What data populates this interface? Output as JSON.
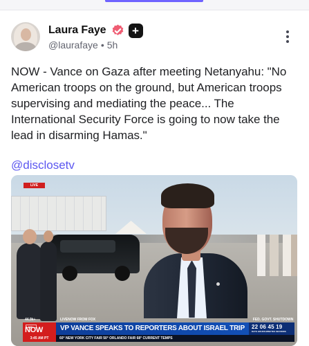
{
  "post": {
    "author_name": "Laura Faye",
    "handle": "@laurafaye",
    "separator": "•",
    "age": "5h",
    "text": "NOW - Vance on Gaza after meeting Netanyahu: \"No American troops on the ground, but American troops supervising and mediating the peace... The International Security Force is going to now take the lead in disarming Hamas.\"",
    "link": "@disclosetv",
    "avatar": "avatar",
    "verified_icon": "verified-badge-icon",
    "plus_icon": "plus-icon",
    "plus_glyph": "+",
    "more_icon": "more-vertical-icon"
  },
  "video": {
    "live_label": "LIVE",
    "lower_third": {
      "stats": "44.9k+",
      "source": "LIVENOW FROM FOX",
      "top_right": "FED. GOVT. SHUTDOWN",
      "small_live": "LIVE",
      "now": "NOW",
      "headline": "VP VANCE SPEAKS TO REPORTERS ABOUT ISRAEL TRIP",
      "clock_values": "22  06  45  19",
      "clock_labels": "DAYS   HOURS   MINUTES   SECONDS",
      "ticker_time": "3:45 AM PT",
      "ticker": "60°  NEW YORK CITY  FAIR 50°  ORLANDO  FAIR 68°  CURRENT TEMPS"
    }
  },
  "colors": {
    "link": "#5b56f0",
    "accent": "#6f63ff",
    "text": "#202124",
    "muted": "#62646f",
    "verified_badge": "#ef5d73",
    "news_blue": "#0c3a93",
    "news_red": "#d31d1d"
  }
}
